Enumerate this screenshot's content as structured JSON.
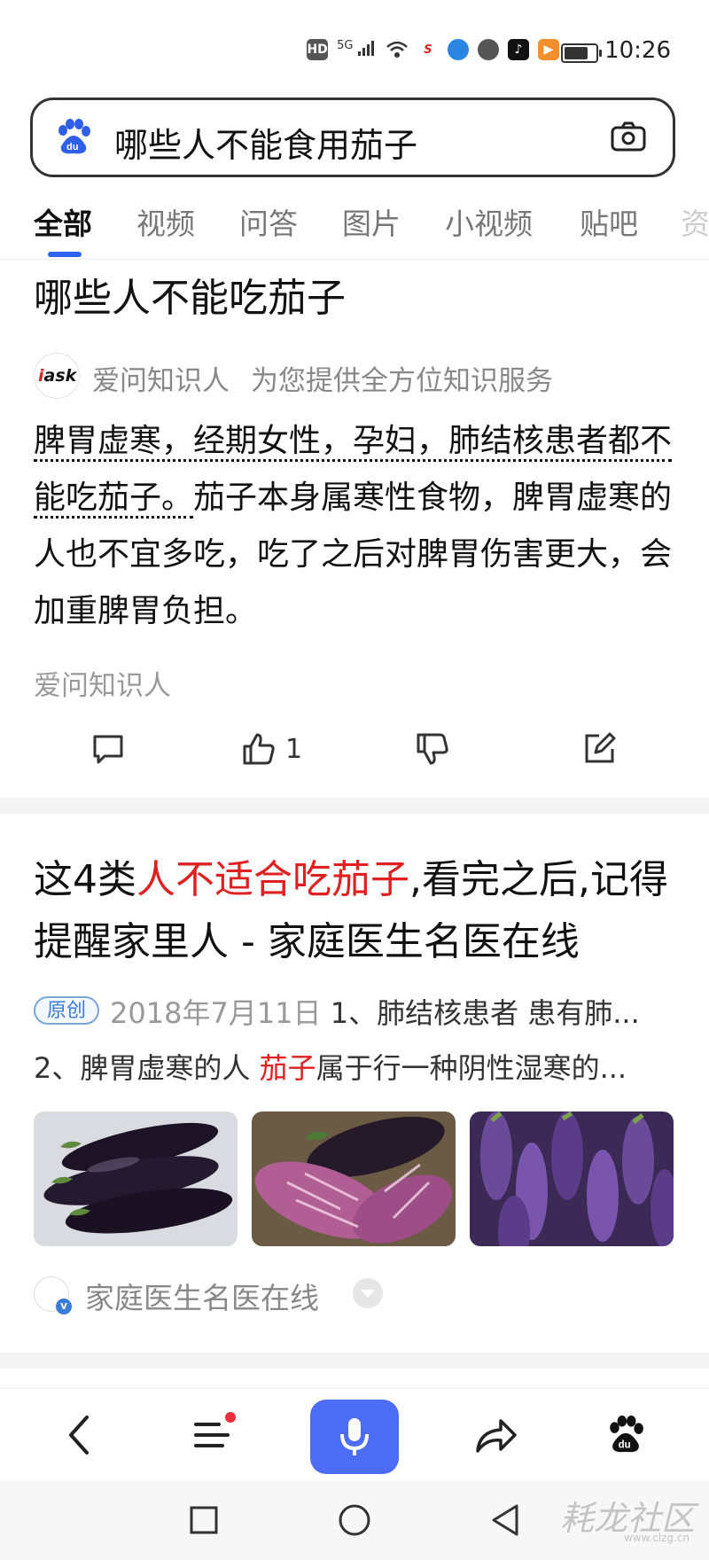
{
  "status_bar": {
    "time": "10:26",
    "network": "5G",
    "hd_label": "HD",
    "more": "···"
  },
  "search": {
    "query": "哪些人不能食用茄子",
    "brand_icon": "baidu-paw-icon",
    "camera_icon": "camera-icon"
  },
  "tabs": [
    {
      "label": "全部"
    },
    {
      "label": "视频"
    },
    {
      "label": "问答"
    },
    {
      "label": "图片"
    },
    {
      "label": "小视频"
    },
    {
      "label": "贴吧"
    },
    {
      "label": "资"
    }
  ],
  "card1": {
    "title": "哪些人不能吃茄子",
    "source_logo_text": "ask",
    "source_logo_prefix": "i",
    "source_name": "爱问知识人",
    "source_desc": "为您提供全方位知识服务",
    "answer_dotted": "脾胃虚寒，经期女性，孕妇，肺结核患者都不能吃茄子。",
    "answer_rest": "茄子本身属寒性食物，脾胃虚寒的人也不宜多吃，吃了之后对脾胃伤害更大，会加重脾胃负担。",
    "author": "爱问知识人",
    "actions": {
      "comment_icon": "comment-icon",
      "like_icon": "thumbs-up-icon",
      "like_count": "1",
      "dislike_icon": "thumbs-down-icon",
      "edit_icon": "edit-icon"
    }
  },
  "card2": {
    "title_prefix": "这4类",
    "title_highlight": "人不适合吃茄子",
    "title_suffix": ",看完之后,记得提醒家里人 - 家庭医生名医在线",
    "badge": "原创",
    "date": "2018年7月11日",
    "snippet1": "1、肺结核患者 患有肺...",
    "snippet2_prefix": "2、脾胃虚寒的人 ",
    "snippet2_highlight": "茄子",
    "snippet2_suffix": "属于行一种阴性湿寒的...",
    "source_name": "家庭医生名医在线"
  },
  "toolbar": {
    "back_icon": "back-arrow-icon",
    "menu_icon": "menu-icon",
    "voice_icon": "microphone-icon",
    "share_icon": "share-icon",
    "home_icon": "baidu-paw-icon"
  },
  "navbar": {
    "recent_icon": "square-icon",
    "home_icon": "circle-icon",
    "back_icon": "triangle-back-icon",
    "watermark": "耗龙社区",
    "watermark_url": "www.clzg.cn"
  },
  "colors": {
    "accent": "#2d64f0",
    "highlight": "#e02020",
    "mic_button": "#4c6cf5"
  }
}
